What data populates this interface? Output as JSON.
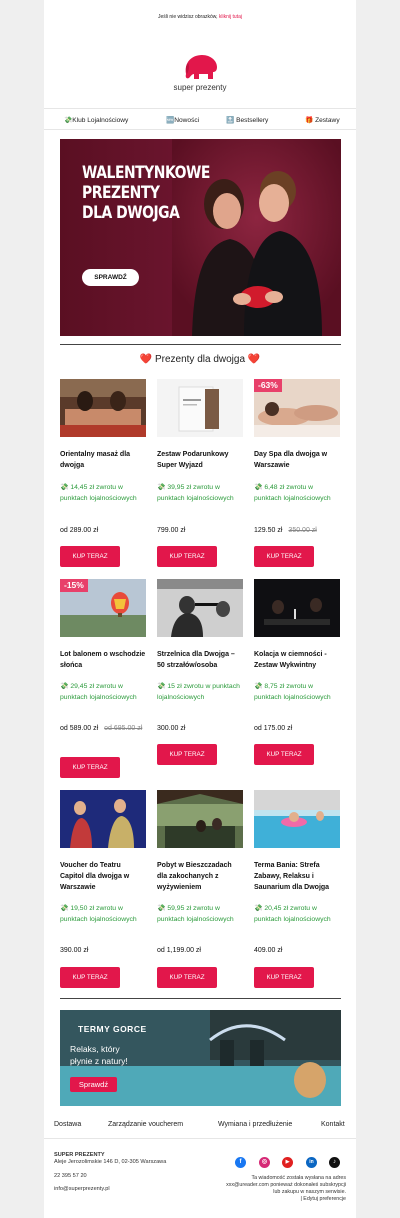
{
  "preheader": {
    "text": "Jeśli nie widzisz obrazków,",
    "link": "kliknij tutaj"
  },
  "brand": {
    "name": "super prezenty",
    "accent": "#e2174b"
  },
  "nav": [
    {
      "icon": "money-icon",
      "glyph": "💸",
      "label": "Klub Lojalnościowy"
    },
    {
      "icon": "new-icon",
      "glyph": "🆕",
      "label": "Nowości"
    },
    {
      "icon": "top-icon",
      "glyph": "🔝",
      "label": "Bestsellery"
    },
    {
      "icon": "gift-icon",
      "glyph": "🎁",
      "label": "Zestawy"
    }
  ],
  "hero": {
    "headline": [
      "WALENTYNKOWE",
      "PREZENTY",
      "DLA DWOJGA"
    ],
    "cta": "SPRAWDŹ"
  },
  "section": {
    "title": "Prezenty dla dwojga",
    "heart": "❤️"
  },
  "products": [
    {
      "name": "Orientalny masaż dla dwojga",
      "cashback": "💸 14,45 zł zwrotu w punktach lojalnościowych",
      "price": "od 289.00 zł",
      "old_price": "",
      "discount": "",
      "cta": "KUP TERAZ"
    },
    {
      "name": "Zestaw Podarunkowy Super Wyjazd",
      "cashback": "💸 39,95 zł zwrotu w punktach lojalnościowych",
      "price": "799.00 zł",
      "old_price": "",
      "discount": "",
      "cta": "KUP TERAZ"
    },
    {
      "name": "Day Spa dla dwojga w Warszawie",
      "cashback": "💸 6,48 zł zwrotu w punktach lojalnościowych",
      "price": "129.50 zł",
      "old_price": "350.00 zł",
      "discount": "-63%",
      "cta": "KUP TERAZ"
    },
    {
      "name": "Lot balonem o wschodzie słońca",
      "cashback": "💸 29,45 zł zwrotu w punktach lojalnościowych",
      "price": "od 589.00 zł",
      "old_price": "od 695.00 zł",
      "discount": "-15%",
      "cta": "KUP TERAZ"
    },
    {
      "name": "Strzelnica dla Dwojga – 50 strzałów/osoba",
      "cashback": "💸 15 zł zwrotu w punktach lojalnościowych",
      "price": "300.00 zł",
      "old_price": "",
      "discount": "",
      "cta": "KUP TERAZ"
    },
    {
      "name": "Kolacja w ciemności - Zestaw Wykwintny",
      "cashback": "💸 8,75 zł zwrotu w punktach lojalnościowych",
      "price": "od 175.00 zł",
      "old_price": "",
      "discount": "",
      "cta": "KUP TERAZ"
    },
    {
      "name": "Voucher do Teatru Capitol dla dwojga w Warszawie",
      "cashback": "💸 19,50 zł zwrotu w punktach lojalnościowych",
      "price": "390.00 zł",
      "old_price": "",
      "discount": "",
      "cta": "KUP TERAZ"
    },
    {
      "name": "Pobyt w Bieszczadach dla zakochanych z wyżywieniem",
      "cashback": "💸 59,95 zł zwrotu w punktach lojalnościowych",
      "price": "od 1,199.00 zł",
      "old_price": "",
      "discount": "",
      "cta": "KUP TERAZ"
    },
    {
      "name": "Terma Bania: Strefa Zabawy, Relaksu i Saunarium dla Dwojga",
      "cashback": "💸 20,45 zł zwrotu w punktach lojalnościowych",
      "price": "409.00 zł",
      "old_price": "",
      "discount": "",
      "cta": "KUP TERAZ"
    }
  ],
  "banner": {
    "logo": "TERMY GORCE",
    "text": [
      "Relaks, który",
      "płynie z natury!"
    ],
    "cta": "Sprawdź"
  },
  "footer": {
    "links": [
      "Dostawa",
      "Zarządzanie voucherem",
      "Wymiana i przedłużenie",
      "Kontakt"
    ],
    "company": "SUPER PREZENTY",
    "address": "Aleje Jerozolimskie 146 D, 02-305 Warszawa",
    "phone": "22 395 57 20",
    "email": "info@superprezenty.pl",
    "note": [
      "Ta wiadomość została wysłana na adres",
      "xxx@ureader.com ponieważ dokonałeś subskrypcji",
      "lub zakupu w naszym serwisie.",
      "| Edytuj preferencje"
    ],
    "socials": [
      {
        "name": "facebook-icon",
        "glyph": "f",
        "color": "#1877f2"
      },
      {
        "name": "instagram-icon",
        "glyph": "◎",
        "color": "#d62976"
      },
      {
        "name": "youtube-icon",
        "glyph": "▶",
        "color": "#e02020"
      },
      {
        "name": "linkedin-icon",
        "glyph": "in",
        "color": "#0a66c2"
      },
      {
        "name": "tiktok-icon",
        "glyph": "♪",
        "color": "#111111"
      }
    ]
  }
}
